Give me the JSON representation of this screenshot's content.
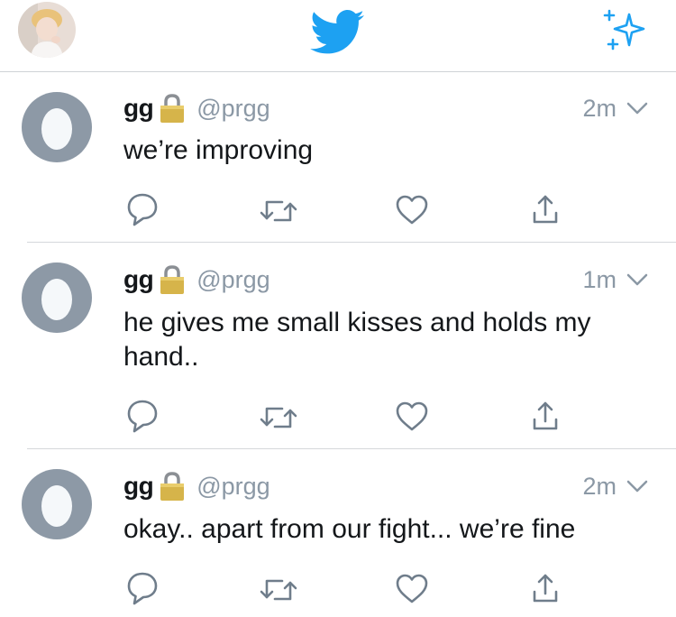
{
  "header": {
    "avatar_icon": "profile-photo-avatar",
    "logo_icon": "twitter-bird-logo",
    "sparkle_icon": "sparkle-top-tweets-icon",
    "accent_color": "#1da1f2"
  },
  "tweets": [
    {
      "name": "gg",
      "handle": "@prgg",
      "time": "2m",
      "text": "we’re improving"
    },
    {
      "name": "gg",
      "handle": "@prgg",
      "time": "1m",
      "text": "he gives me small kisses and holds my hand.."
    },
    {
      "name": "gg",
      "handle": "@prgg",
      "time": "2m",
      "text": "okay.. apart from our fight... we’re fine"
    }
  ],
  "actions": [
    "reply-icon",
    "retweet-icon",
    "like-icon",
    "share-icon"
  ],
  "colors": {
    "muted": "#8b98a5",
    "icon": "#6f7d8b",
    "divider": "#d5d8db",
    "egg_bg": "#8d99a6"
  }
}
